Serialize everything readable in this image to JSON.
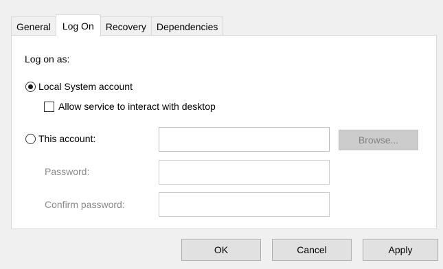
{
  "tabs": [
    {
      "label": "General",
      "active": false
    },
    {
      "label": "Log On",
      "active": true
    },
    {
      "label": "Recovery",
      "active": false
    },
    {
      "label": "Dependencies",
      "active": false
    }
  ],
  "logon": {
    "heading": "Log on as:",
    "local_system_label": "Local System account",
    "local_system_selected": true,
    "interact_desktop_label": "Allow service to interact with desktop",
    "interact_desktop_checked": false,
    "this_account_label": "This account:",
    "this_account_selected": false,
    "account_value": "",
    "browse_label": "Browse...",
    "password_label": "Password:",
    "password_value": "",
    "confirm_password_label": "Confirm password:",
    "confirm_password_value": ""
  },
  "footer": {
    "ok_label": "OK",
    "cancel_label": "Cancel",
    "apply_label": "Apply"
  },
  "colors": {
    "dialog_background": "#f0f0f0",
    "panel_background": "#ffffff",
    "disabled_text": "#8a8a8a"
  }
}
